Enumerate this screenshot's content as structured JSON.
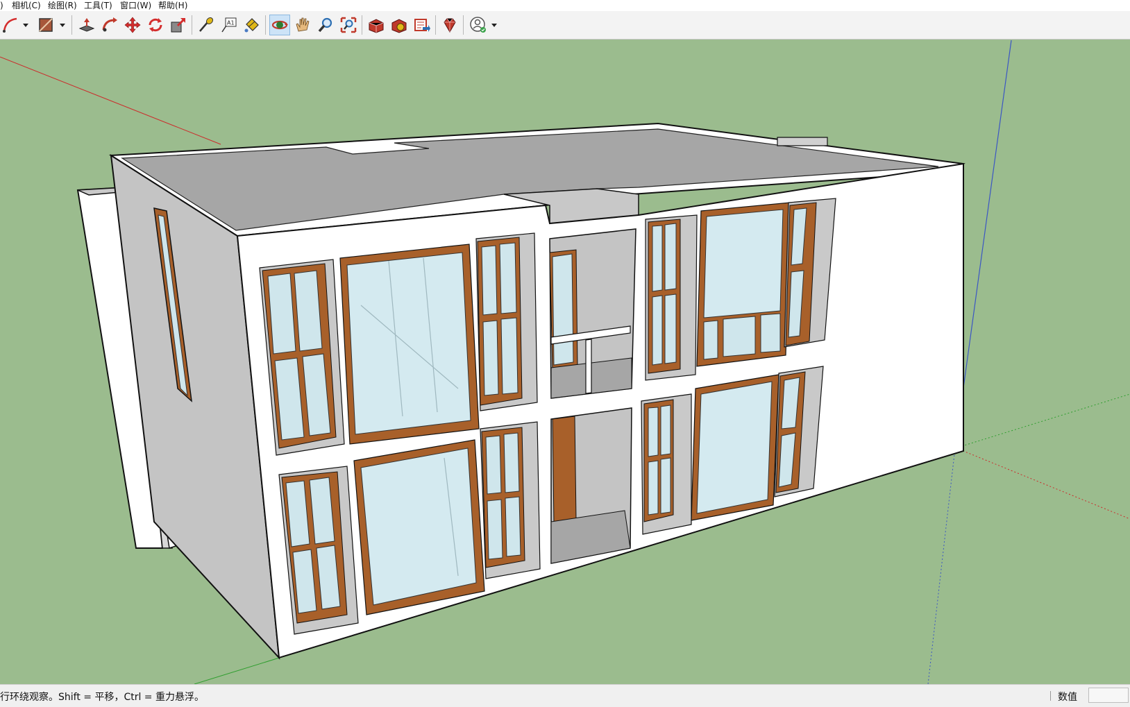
{
  "menu": {
    "items": [
      {
        "label": ")"
      },
      {
        "label": "相机(C)"
      },
      {
        "label": "绘图(R)"
      },
      {
        "label": "工具(T)"
      },
      {
        "label": "窗口(W)"
      },
      {
        "label": "帮助(H)"
      }
    ]
  },
  "toolbar": {
    "tools": [
      {
        "icon": "arc-tool-icon",
        "color": "#d42d2d"
      },
      {
        "icon": "shape-tool-icon",
        "color": "#a7573a"
      },
      {
        "icon": "push-pull-icon",
        "color": "#c0392b"
      },
      {
        "icon": "follow-me-icon",
        "color": "#c0392b"
      },
      {
        "icon": "move-icon",
        "color": "#d42d2d"
      },
      {
        "icon": "rotate-icon",
        "color": "#d42d2d"
      },
      {
        "icon": "scale-icon",
        "color": "#d42d2d"
      },
      {
        "icon": "tape-measure-icon",
        "color": "#e0b818"
      },
      {
        "icon": "text-icon",
        "color": "#555555"
      },
      {
        "icon": "paint-bucket-icon",
        "color": "#e0b818"
      },
      {
        "icon": "orbit-icon",
        "color": "#2e7d32",
        "active": true
      },
      {
        "icon": "pan-icon",
        "color": "#e6b97d"
      },
      {
        "icon": "zoom-icon",
        "color": "#2d6fb3"
      },
      {
        "icon": "zoom-extents-icon",
        "color": "#c0392b"
      },
      {
        "icon": "warehouse-icon",
        "color": "#c0392b"
      },
      {
        "icon": "extension-warehouse-icon",
        "color": "#c0392b"
      },
      {
        "icon": "layout-icon",
        "color": "#c0392b"
      },
      {
        "icon": "ruby-console-icon",
        "color": "#c0392b"
      },
      {
        "icon": "account-icon",
        "color": "#555555"
      }
    ],
    "text_tool_glyph": "A1"
  },
  "status": {
    "hint": "行环绕观察。Shift = 平移，Ctrl = 重力悬浮。",
    "measurements_label": "数值",
    "measurements_value": ""
  },
  "colors": {
    "sky_ground": "#9bbc8e",
    "wall": "#ffffff",
    "roof": "#a6a6a6",
    "glass": "#cfe6ec",
    "frame": "#a8602a",
    "axis_red": "#cc2b2b",
    "axis_green": "#2e9e2e",
    "axis_blue": "#3b56c4"
  }
}
